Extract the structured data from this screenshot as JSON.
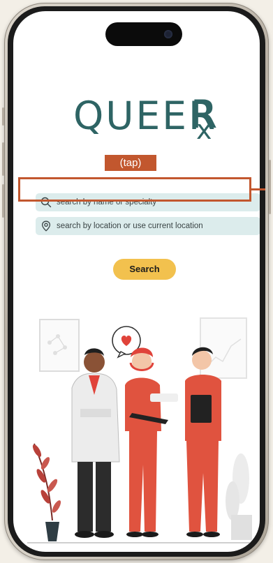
{
  "app": {
    "logo_word": "QUEER",
    "logo_rx": "R",
    "logo_rx_tail": "x"
  },
  "annotation": {
    "tap_label": "(tap)"
  },
  "search": {
    "name_placeholder": "search by name or specialty",
    "location_placeholder": "search by location or use current location",
    "button_label": "Search"
  },
  "colors": {
    "brand": "#2e6464",
    "accent": "#f2c14e",
    "field_bg": "#dcecec",
    "annotation": "#c2572e"
  },
  "icons": {
    "name_field": "search-icon",
    "location_field": "location-pin-icon"
  }
}
